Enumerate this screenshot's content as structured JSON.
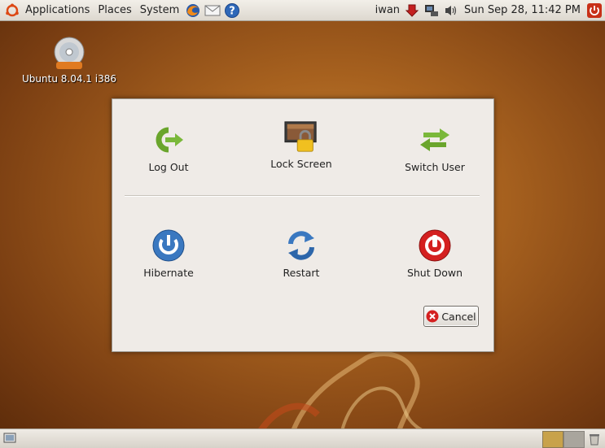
{
  "top_panel": {
    "menus": [
      "Applications",
      "Places",
      "System"
    ],
    "user": "iwan",
    "clock": "Sun Sep 28, 11:42 PM"
  },
  "desktop": {
    "icon_label": "Ubuntu 8.04.1 i386",
    "icon_badge": "DVD-ROM"
  },
  "dialog": {
    "actions": [
      {
        "label": "Log Out",
        "icon": "logout-icon"
      },
      {
        "label": "Lock Screen",
        "icon": "lock-screen-icon"
      },
      {
        "label": "Switch User",
        "icon": "switch-user-icon"
      },
      {
        "label": "Hibernate",
        "icon": "hibernate-icon"
      },
      {
        "label": "Restart",
        "icon": "restart-icon"
      },
      {
        "label": "Shut Down",
        "icon": "shut-down-icon"
      }
    ],
    "cancel_label": "Cancel"
  },
  "colors": {
    "desktop_bg": "#a8621f",
    "dialog_bg": "#efebe7",
    "green": "#7ab83a",
    "blue": "#3a78c0",
    "red": "#d42020"
  }
}
